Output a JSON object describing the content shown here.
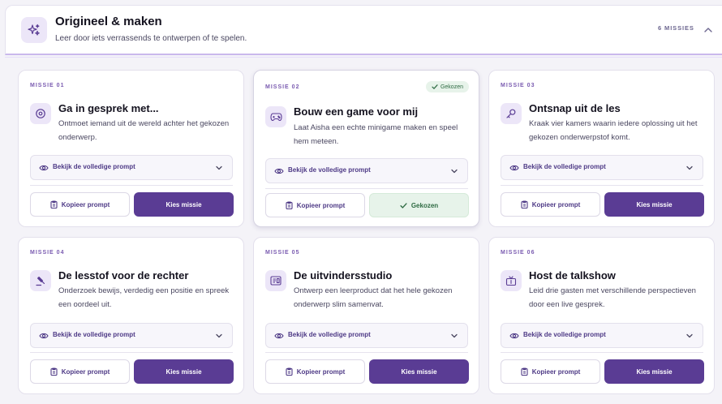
{
  "header": {
    "icon": "sparkles-icon",
    "title": "Origineel & maken",
    "subtitle": "Leer door iets verrassends te ontwerpen of te spelen.",
    "count": "6 MISSIES",
    "collapse_icon": "chevron-up-icon"
  },
  "colors": {
    "accent": "#5a3c94",
    "accent_light": "#ece6f8",
    "success_bg": "#e7f3ea",
    "success_text": "#2f6b43"
  },
  "missions": [
    {
      "number": "MISSIE 01",
      "title": "Ga in gesprek met...",
      "description": "Ontmoet iemand uit de wereld achter het gekozen onderwerp.",
      "icon": "chat-icon",
      "prompt_label": "Bekijk de volledige prompt",
      "copy_label": "Kopieer prompt",
      "pick_label": "Kies missie"
    },
    {
      "number": "MISSIE 02",
      "title": "Bouw een game voor mij",
      "description": "Laat Aisha een echte minigame maken en speel hem meteen.",
      "icon": "gamepad-icon",
      "badge": "Gekozen",
      "prompt_label": "Bekijk de volledige prompt",
      "copy_label": "Kopieer prompt",
      "pick_label": "Gekozen"
    },
    {
      "number": "MISSIE 03",
      "title": "Ontsnap uit de les",
      "description": "Kraak vier kamers waarin iedere oplossing uit het gekozen onderwerpstof komt.",
      "icon": "key-icon",
      "prompt_label": "Bekijk de volledige prompt",
      "copy_label": "Kopieer prompt",
      "pick_label": "Kies missie"
    },
    {
      "number": "MISSIE 04",
      "title": "De lesstof voor de rechter",
      "description": "Onderzoek bewijs, verdedig een positie en spreek een oordeel uit.",
      "icon": "gavel-icon",
      "prompt_label": "Bekijk de volledige prompt",
      "copy_label": "Kopieer prompt",
      "pick_label": "Kies missie"
    },
    {
      "number": "MISSIE 05",
      "title": "De uitvindersstudio",
      "description": "Ontwerp een leerproduct dat het hele gekozen onderwerp slim samenvat.",
      "icon": "product-icon",
      "prompt_label": "Bekijk de volledige prompt",
      "copy_label": "Kopieer prompt",
      "pick_label": "Kies missie"
    },
    {
      "number": "MISSIE 06",
      "title": "Host de talkshow",
      "description": "Leid drie gasten met verschillende perspectieven door een live gesprek.",
      "icon": "tv-icon",
      "prompt_label": "Bekijk de volledige prompt",
      "copy_label": "Kopieer prompt",
      "pick_label": "Kies missie"
    }
  ]
}
